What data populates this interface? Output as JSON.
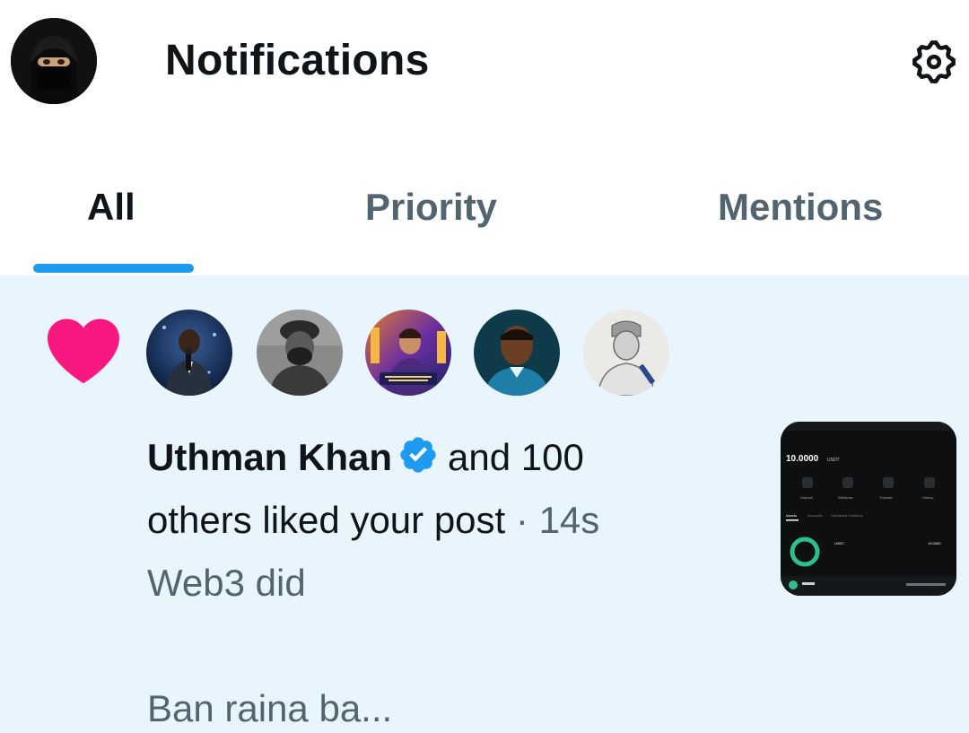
{
  "header": {
    "title": "Notifications"
  },
  "tabs": [
    {
      "label": "All"
    },
    {
      "label": "Priority"
    },
    {
      "label": "Mentions"
    }
  ],
  "notification": {
    "name": "Uthman Khan",
    "action_part1": "and 100",
    "action_part2": "others liked your post",
    "separator": "·",
    "time": "14s",
    "preview_line1": "Web3 did",
    "preview_line2": "Ban raina ba...",
    "thumbnail": {
      "balance": "10.0000",
      "currency": "USDT",
      "labels": [
        "Deposit",
        "Withdraw",
        "Transfer",
        "History"
      ],
      "tabs": [
        "Assets",
        "Accounts",
        "Combined Positions"
      ],
      "asset": "USDT",
      "asset_value": "10.0000"
    }
  },
  "colors": {
    "accent": "#1d9bf0",
    "heart": "#f91880",
    "highlight_bg": "#e8f5fd",
    "muted_text": "#536471"
  },
  "icons": {
    "settings": "gear-icon",
    "like": "heart-icon",
    "verified": "verified-badge-icon"
  }
}
